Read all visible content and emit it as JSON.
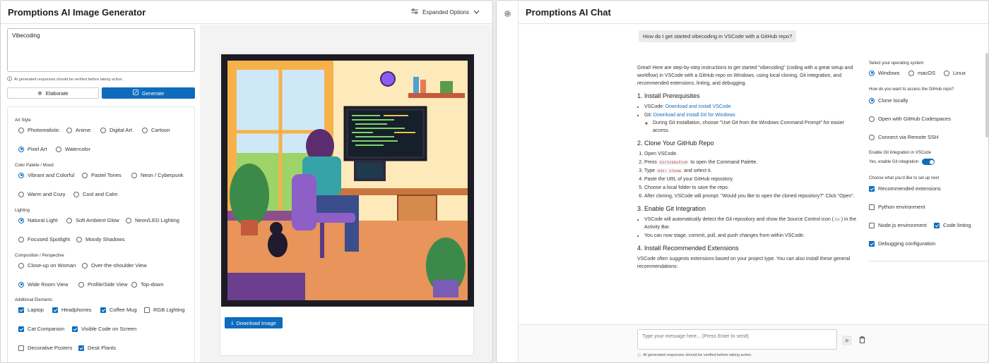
{
  "left": {
    "title": "Promptions AI Image Generator",
    "expanded_options": "Expanded Options",
    "prompt_value": "Vibecoding",
    "disclaimer": "AI generated responses should be verified before taking action.",
    "elaborate": "Elaborate",
    "generate": "Generate",
    "download": "Download Image",
    "sections": {
      "art_style": "Art Style",
      "palette": "Color Palette / Mood",
      "lighting": "Lighting",
      "composition": "Composition / Perspective",
      "elements": "Additional Elements"
    },
    "art_style": [
      "Photorealistic",
      "Anime",
      "Digital Art",
      "Cartoon",
      "Pixel Art",
      "Watercolor"
    ],
    "art_style_selected": "Pixel Art",
    "palette": [
      "Vibrant and Colorful",
      "Pastel Tones",
      "Neon / Cyberpunk",
      "Warm and Cozy",
      "Cool and Calm"
    ],
    "palette_selected": "Vibrant and Colorful",
    "lighting": [
      "Natural Light",
      "Soft Ambient Glow",
      "Neon/LED Lighting",
      "Focused Spotlight",
      "Moody Shadows"
    ],
    "lighting_selected": "Natural Light",
    "composition": [
      "Close-up on Woman",
      "Over-the-shoulder View",
      "Wide Room View",
      "Profile/Side View",
      "Top-down"
    ],
    "composition_selected": "Wide Room View",
    "elements": [
      {
        "label": "Laptop",
        "checked": true
      },
      {
        "label": "Headphones",
        "checked": true
      },
      {
        "label": "Coffee Mug",
        "checked": true
      },
      {
        "label": "RGB Lighting",
        "checked": false
      },
      {
        "label": "Cat Companion",
        "checked": true
      },
      {
        "label": "Visible Code on Screen",
        "checked": true
      },
      {
        "label": "Decorative Posters",
        "checked": false
      },
      {
        "label": "Desk Plants",
        "checked": true
      }
    ]
  },
  "right": {
    "title": "Promptions AI Chat",
    "user_message": "How do I get started vibecoding in VSCode with a GitHub repo?",
    "intro": "Great! Here are step-by-step instructions to get started \"vibecoding\" (coding with a great setup and workflow) in VSCode with a GitHub repo on Windows, using local cloning, Git integration, and recommended extensions, linting, and debugging.",
    "h1": "1. Install Prerequisites",
    "s1": {
      "vscode_label": "VSCode:",
      "vscode_link": "Download and install VSCode",
      "git_label": "Git:",
      "git_link": "Download and install Git for Windows",
      "git_sub": "During Git installation, choose \"Use Git from the Windows Command Prompt\" for easier access."
    },
    "h2": "2. Clone Your GitHub Repo",
    "s2": {
      "i1": "Open VSCode.",
      "i2a": "Press",
      "i2k": "Ctrl+Shift+P",
      "i2b": "to open the Command Palette.",
      "i3a": "Type",
      "i3k": "Git: Clone",
      "i3b": "and select it.",
      "i4": "Paste the URL of your GitHub repository.",
      "i5": "Choose a local folder to save the repo.",
      "i6": "After cloning, VSCode will prompt: \"Would you like to open the cloned repository?\" Click \"Open\"."
    },
    "h3": "3. Enable Git Integration",
    "s3": {
      "i1a": "VSCode will automatically detect the Git repository and show the Source Control icon (",
      "i1k": "<>",
      "i1b": ") in the Activity Bar.",
      "i2": "You can now stage, commit, pull, and push changes from within VSCode."
    },
    "h4": "4. Install Recommended Extensions",
    "s4": "VSCode often suggests extensions based on your project type. You can also install these general recommendations:",
    "form": {
      "q_os": "Select your operating system",
      "os": [
        "Windows",
        "macOS",
        "Linux"
      ],
      "os_selected": "Windows",
      "q_access": "How do you want to access the GitHub repo?",
      "access": [
        "Clone locally",
        "Open with GitHub Codespaces",
        "Connect via Remote SSH"
      ],
      "access_selected": "Clone locally",
      "q_git": "Enable Git integration in VSCode",
      "git_toggle": "Yes, enable Git integration",
      "q_setup": "Choose what you'd like to set up next",
      "setup": [
        {
          "label": "Recommended extensions",
          "checked": true
        },
        {
          "label": "Python environment",
          "checked": false
        },
        {
          "label": "Node.js environment",
          "checked": false
        },
        {
          "label": "Code linting",
          "checked": true
        },
        {
          "label": "Debugging configuration",
          "checked": true
        }
      ]
    },
    "input_placeholder": "Type your message here... (Press Enter to send)",
    "ai_note": "AI generated responses should be verified before taking action."
  }
}
